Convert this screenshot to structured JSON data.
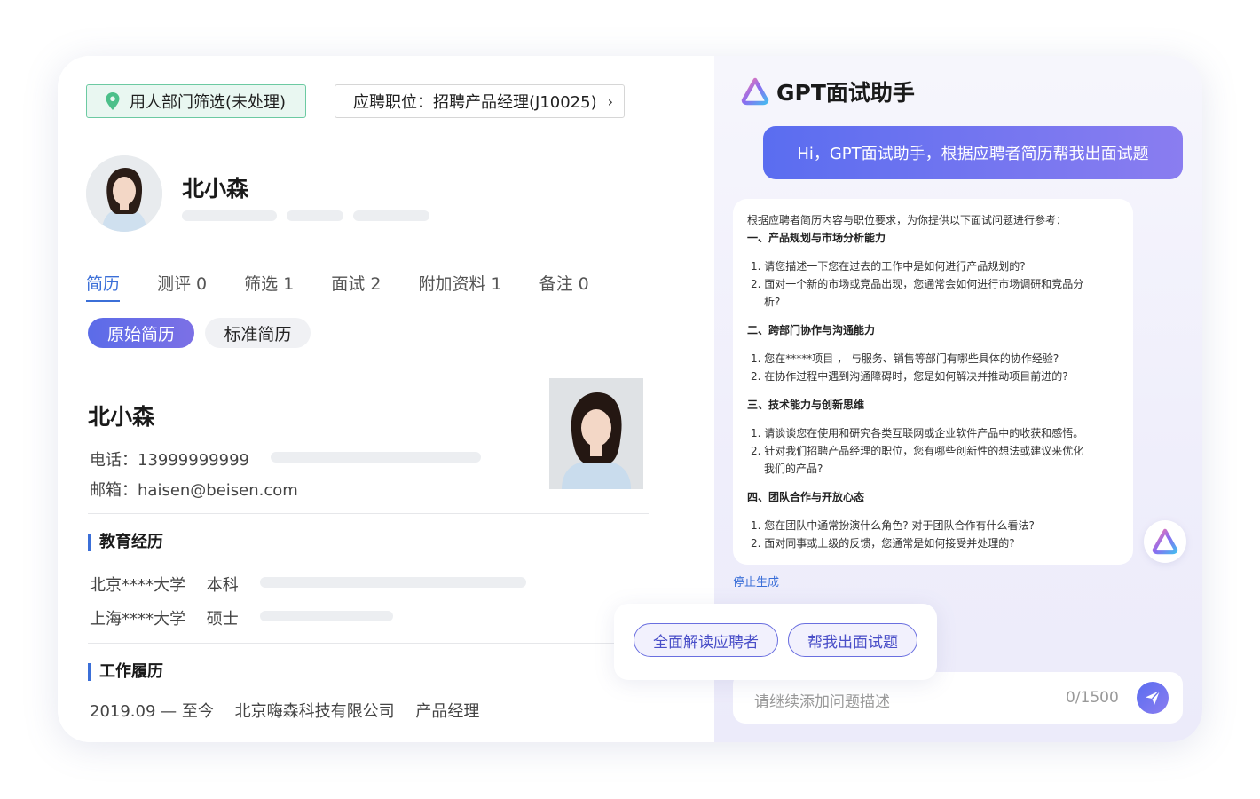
{
  "header": {
    "status_label": "用人部门筛选(未处理)",
    "job_label": "应聘职位：招聘产品经理(J10025)",
    "job_arrow": "›"
  },
  "candidate": {
    "name": "北小森"
  },
  "tabs": [
    {
      "label": "简历"
    },
    {
      "label": "测评 0"
    },
    {
      "label": "筛选 1"
    },
    {
      "label": "面试 2"
    },
    {
      "label": "附加资料 1"
    },
    {
      "label": "备注 0"
    }
  ],
  "resume_toggle": {
    "original": "原始简历",
    "standard": "标准简历"
  },
  "resume": {
    "name": "北小森",
    "phone": "电话：13999999999",
    "email": "邮箱：haisen@beisen.com",
    "education_title": "教育经历",
    "education": [
      {
        "school": "北京****大学",
        "degree": "本科"
      },
      {
        "school": "上海****大学",
        "degree": "硕士"
      }
    ],
    "work_title": "工作履历",
    "work": {
      "period": "2019.09 — 至今",
      "company": "北京嗨森科技有限公司",
      "role": "产品经理"
    }
  },
  "assistant": {
    "title": "GPT面试助手",
    "user_message": "Hi，GPT面试助手，根据应聘者简历帮我出面试题",
    "answer": {
      "intro": "根据应聘者简历内容与职位要求，为你提供以下面试问题进行参考：",
      "sections": [
        {
          "heading": "一、产品规划与市场分析能力",
          "questions": [
            "1. 请您描述一下您在过去的工作中是如何进行产品规划的?",
            "2. 面对一个新的市场或竞品出现，您通常会如何进行市场调研和竞品分",
            "析?"
          ]
        },
        {
          "heading": "二、跨部门协作与沟通能力",
          "questions": [
            "1. 您在*****项目 ， 与服务、销售等部门有哪些具体的协作经验?",
            "2. 在协作过程中遇到沟通障碍时，您是如何解决并推动项目前进的?"
          ]
        },
        {
          "heading": "三、技术能力与创新思维",
          "questions": [
            "1. 请谈谈您在使用和研究各类互联网或企业软件产品中的收获和感悟。",
            "2. 针对我们招聘产品经理的职位，您有哪些创新性的想法或建议来优化",
            "我们的产品?"
          ]
        },
        {
          "heading": "四、团队合作与开放心态",
          "questions": [
            "1. 您在团队中通常扮演什么角色? 对于团队合作有什么看法?",
            "2. 面对同事或上级的反馈，您通常是如何接受并处理的?"
          ]
        }
      ]
    },
    "stop_label": "停止生成",
    "quick_actions": {
      "interpret": "全面解读应聘者",
      "questions": "帮我出面试题"
    },
    "input": {
      "placeholder": "请继续添加问题描述",
      "counter": "0/1500"
    }
  },
  "colors": {
    "accent": "#3b6fd8",
    "gradient_start": "#5a6df0",
    "gradient_end": "#8a7df0",
    "status_border": "#6ccaa2"
  }
}
